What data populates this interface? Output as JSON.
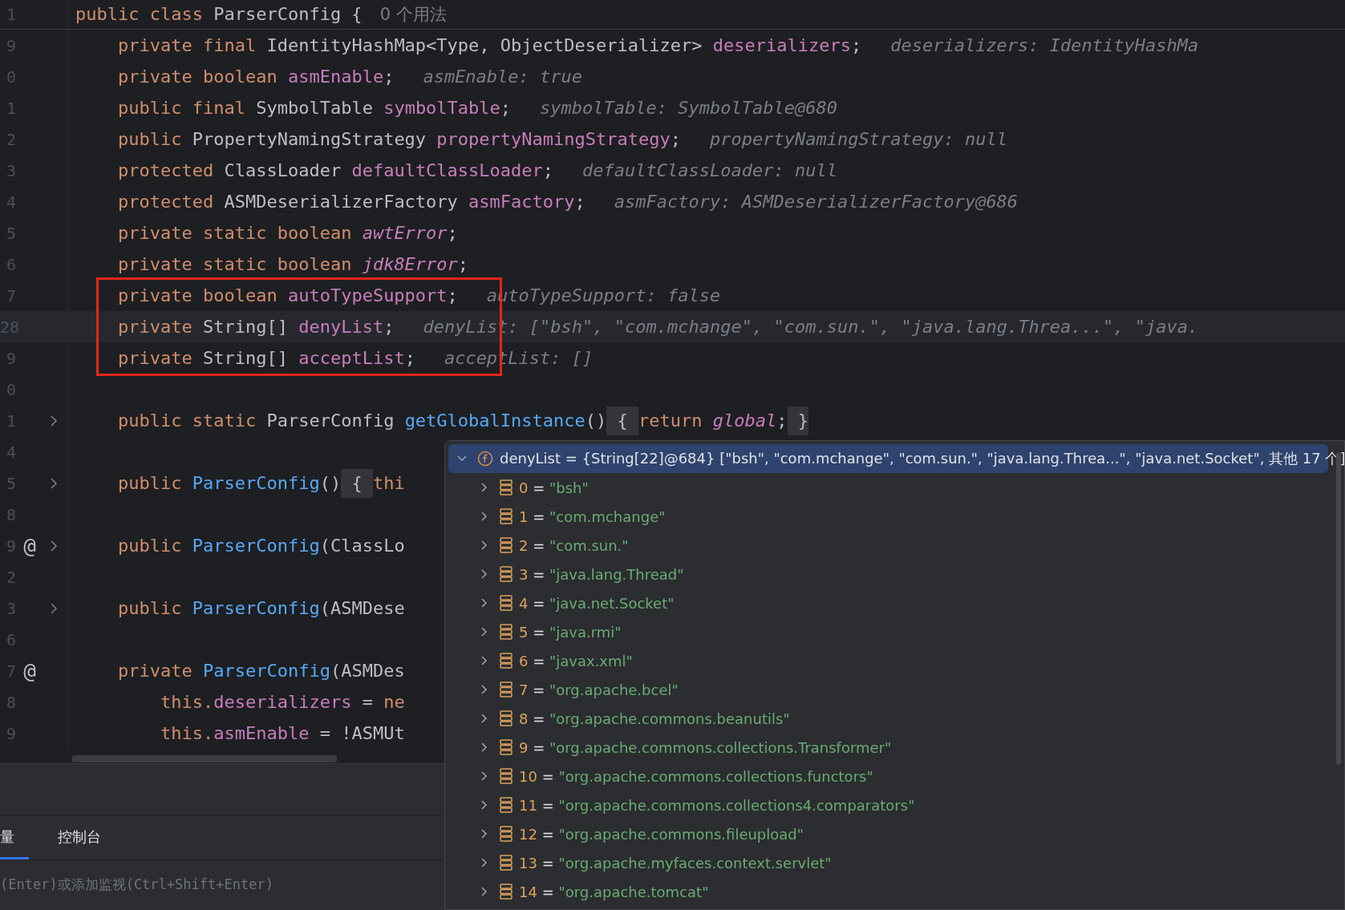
{
  "editor": {
    "sticky_line": {
      "number": "1",
      "segments": [
        {
          "kind": "keyword",
          "t": "public class "
        },
        {
          "kind": "plain",
          "t": "ParserConfig {"
        }
      ],
      "usages": "0 个用法"
    },
    "lines": [
      {
        "kind": "line",
        "number": "9",
        "segments": [
          {
            "kind": "keyword",
            "t": "private final "
          },
          {
            "kind": "plain",
            "t": "IdentityHashMap<Type, ObjectDeserializer> "
          },
          {
            "kind": "field",
            "t": "deserializers"
          },
          {
            "kind": "plain",
            "t": ";"
          }
        ],
        "hint": "deserializers: IdentityHashMa"
      },
      {
        "kind": "line",
        "number": "0",
        "segments": [
          {
            "kind": "keyword",
            "t": "private boolean "
          },
          {
            "kind": "field",
            "t": "asmEnable"
          },
          {
            "kind": "plain",
            "t": ";"
          }
        ],
        "hint": "asmEnable: true"
      },
      {
        "kind": "line",
        "number": "1",
        "segments": [
          {
            "kind": "keyword",
            "t": "public final "
          },
          {
            "kind": "plain",
            "t": "SymbolTable "
          },
          {
            "kind": "field",
            "t": "symbolTable"
          },
          {
            "kind": "plain",
            "t": ";"
          }
        ],
        "hint": "symbolTable: SymbolTable@680"
      },
      {
        "kind": "line",
        "number": "2",
        "segments": [
          {
            "kind": "keyword",
            "t": "public "
          },
          {
            "kind": "plain",
            "t": "PropertyNamingStrategy "
          },
          {
            "kind": "field",
            "t": "propertyNamingStrategy"
          },
          {
            "kind": "plain",
            "t": ";"
          }
        ],
        "hint": "propertyNamingStrategy: null"
      },
      {
        "kind": "line",
        "number": "3",
        "segments": [
          {
            "kind": "keyword",
            "t": "protected "
          },
          {
            "kind": "plain",
            "t": "ClassLoader "
          },
          {
            "kind": "field",
            "t": "defaultClassLoader"
          },
          {
            "kind": "plain",
            "t": ";"
          }
        ],
        "hint": "defaultClassLoader: null"
      },
      {
        "kind": "line",
        "number": "4",
        "segments": [
          {
            "kind": "keyword",
            "t": "protected "
          },
          {
            "kind": "plain",
            "t": "ASMDeserializerFactory "
          },
          {
            "kind": "field",
            "t": "asmFactory"
          },
          {
            "kind": "plain",
            "t": ";"
          }
        ],
        "hint": "asmFactory: ASMDeserializerFactory@686"
      },
      {
        "kind": "line",
        "number": "5",
        "segments": [
          {
            "kind": "keyword",
            "t": "private static boolean "
          },
          {
            "kind": "static",
            "t": "awtError"
          },
          {
            "kind": "plain",
            "t": ";"
          }
        ]
      },
      {
        "kind": "line",
        "number": "6",
        "segments": [
          {
            "kind": "keyword",
            "t": "private static boolean "
          },
          {
            "kind": "static",
            "t": "jdk8Error"
          },
          {
            "kind": "plain",
            "t": ";"
          }
        ]
      },
      {
        "kind": "boxed_group",
        "lines": [
          {
            "kind": "line",
            "number": "7",
            "segments": [
              {
                "kind": "keyword",
                "t": "private boolean "
              },
              {
                "kind": "field",
                "t": "autoTypeSupport"
              },
              {
                "kind": "plain",
                "t": ";"
              }
            ],
            "hint": "autoTypeSupport: false"
          },
          {
            "kind": "line",
            "number": "28",
            "current": true,
            "segments": [
              {
                "kind": "keyword",
                "t": "private "
              },
              {
                "kind": "plain",
                "t": "String[] "
              },
              {
                "kind": "field",
                "t": "denyList"
              },
              {
                "kind": "plain",
                "t": ";"
              }
            ],
            "hint": "denyList: [\"bsh\", \"com.mchange\", \"com.sun.\", \"java.lang.Threa...\", \"java."
          },
          {
            "kind": "line",
            "number": "9",
            "segments": [
              {
                "kind": "keyword",
                "t": "private "
              },
              {
                "kind": "plain",
                "t": "String[] "
              },
              {
                "kind": "field",
                "t": "acceptList"
              },
              {
                "kind": "plain",
                "t": ";"
              }
            ],
            "hint": "acceptList: []"
          }
        ]
      },
      {
        "kind": "line",
        "number": "0"
      },
      {
        "kind": "line",
        "number": "1",
        "fold": true,
        "segments": [
          {
            "kind": "keyword",
            "t": "public static "
          },
          {
            "kind": "plain",
            "t": "ParserConfig "
          },
          {
            "kind": "method",
            "t": "getGlobalInstance"
          },
          {
            "kind": "plain",
            "t": "()"
          },
          {
            "kind": "brace",
            "t": " { "
          },
          {
            "kind": "keyword",
            "t": "return "
          },
          {
            "kind": "static",
            "t": "global"
          },
          {
            "kind": "plain",
            "t": ";"
          },
          {
            "kind": "brace",
            "t": " }"
          }
        ]
      },
      {
        "kind": "line",
        "number": "4"
      },
      {
        "kind": "line",
        "number": "5",
        "fold": true,
        "segments": [
          {
            "kind": "keyword",
            "t": "public "
          },
          {
            "kind": "method",
            "t": "ParserConfig"
          },
          {
            "kind": "plain",
            "t": "()"
          },
          {
            "kind": "brace",
            "t": " { "
          },
          {
            "kind": "keyword",
            "t": "thi"
          }
        ]
      },
      {
        "kind": "line",
        "number": "8"
      },
      {
        "kind": "line",
        "number": "9",
        "gutter_mark": "@",
        "fold": true,
        "segments": [
          {
            "kind": "keyword",
            "t": "public "
          },
          {
            "kind": "method",
            "t": "ParserConfig"
          },
          {
            "kind": "plain",
            "t": "(ClassLo"
          }
        ]
      },
      {
        "kind": "line",
        "number": "2"
      },
      {
        "kind": "line",
        "number": "3",
        "fold": true,
        "segments": [
          {
            "kind": "keyword",
            "t": "public "
          },
          {
            "kind": "method",
            "t": "ParserConfig"
          },
          {
            "kind": "plain",
            "t": "(ASMDese"
          }
        ]
      },
      {
        "kind": "line",
        "number": "6"
      },
      {
        "kind": "line",
        "number": "7",
        "gutter_mark": "@",
        "segments": [
          {
            "kind": "keyword",
            "t": "private "
          },
          {
            "kind": "method",
            "t": "ParserConfig"
          },
          {
            "kind": "plain",
            "t": "(ASMDes"
          }
        ],
        "children": [
          {
            "kind": "line",
            "number": "8",
            "segments": [
              {
                "kind": "keyword",
                "t": "this."
              },
              {
                "kind": "field",
                "t": "deserializers"
              },
              {
                "kind": "plain",
                "t": " = "
              },
              {
                "kind": "keyword",
                "t": "ne"
              }
            ]
          },
          {
            "kind": "line",
            "number": "9",
            "segments": [
              {
                "kind": "keyword",
                "t": "this."
              },
              {
                "kind": "field",
                "t": "asmEnable"
              },
              {
                "kind": "plain",
                "t": " = !ASMUt"
              }
            ]
          }
        ]
      }
    ]
  },
  "debug_popup": {
    "header": {
      "name": "denyList",
      "operator": "=",
      "value": "{String[22]@684} [\"bsh\", \"com.mchange\", \"com.sun.\", \"java.lang.Threa...\", \"java.net.Socket\", 其他 17 个]",
      "expanded": true,
      "selected": true
    },
    "items": [
      {
        "index": "0",
        "operator": "=",
        "value": "\"bsh\""
      },
      {
        "index": "1",
        "operator": "=",
        "value": "\"com.mchange\""
      },
      {
        "index": "2",
        "operator": "=",
        "value": "\"com.sun.\""
      },
      {
        "index": "3",
        "operator": "=",
        "value": "\"java.lang.Thread\""
      },
      {
        "index": "4",
        "operator": "=",
        "value": "\"java.net.Socket\""
      },
      {
        "index": "5",
        "operator": "=",
        "value": "\"java.rmi\""
      },
      {
        "index": "6",
        "operator": "=",
        "value": "\"javax.xml\""
      },
      {
        "index": "7",
        "operator": "=",
        "value": "\"org.apache.bcel\""
      },
      {
        "index": "8",
        "operator": "=",
        "value": "\"org.apache.commons.beanutils\""
      },
      {
        "index": "9",
        "operator": "=",
        "value": "\"org.apache.commons.collections.Transformer\""
      },
      {
        "index": "10",
        "operator": "=",
        "value": "\"org.apache.commons.collections.functors\""
      },
      {
        "index": "11",
        "operator": "=",
        "value": "\"org.apache.commons.collections4.comparators\""
      },
      {
        "index": "12",
        "operator": "=",
        "value": "\"org.apache.commons.fileupload\""
      },
      {
        "index": "13",
        "operator": "=",
        "value": "\"org.apache.myfaces.context.servlet\""
      },
      {
        "index": "14",
        "operator": "=",
        "value": "\"org.apache.tomcat\""
      }
    ]
  },
  "bottom_panel": {
    "tabs": [
      {
        "label": "量",
        "selected": true
      },
      {
        "label": "控制台",
        "selected": false
      }
    ],
    "input": {
      "placeholder": "(Enter)或添加监视(Ctrl+Shift+Enter)"
    }
  }
}
